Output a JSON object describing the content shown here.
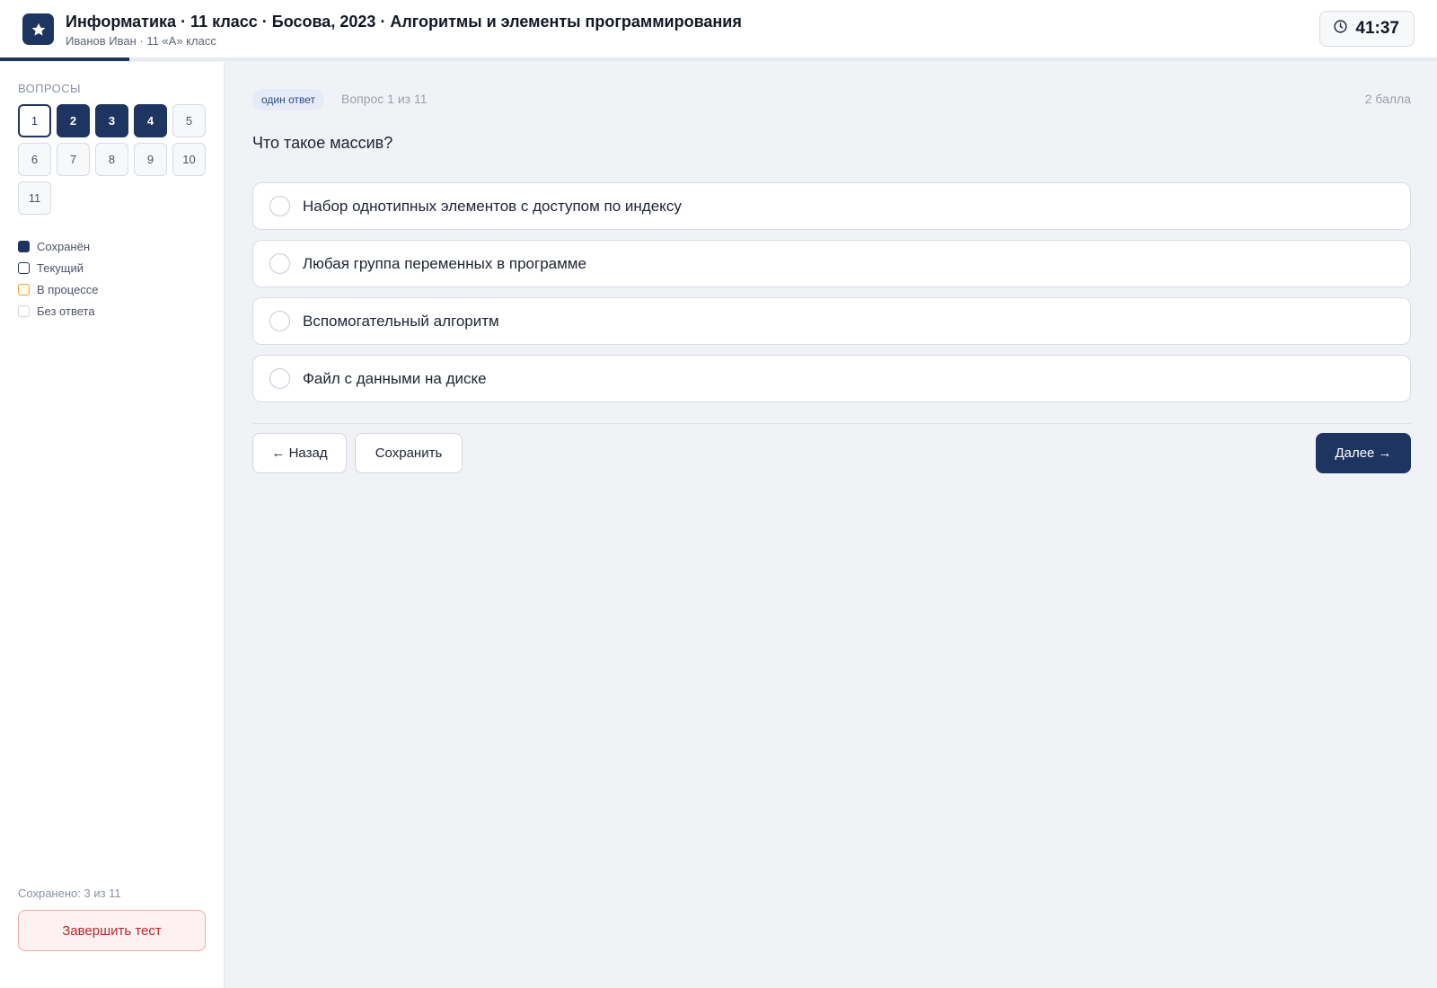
{
  "header": {
    "title": "Информатика · 11 класс · Босова, 2023 · Алгоритмы и элементы программирования",
    "subtitle": "Иванов Иван · 11 «А» класс",
    "timer": "41:37",
    "logo_icon": "star-icon",
    "timer_icon": "clock-icon",
    "progress_fraction": 0.09
  },
  "sidebar": {
    "heading": "ВОПРОСЫ",
    "questions": [
      {
        "label": "1",
        "state": "current"
      },
      {
        "label": "2",
        "state": "saved"
      },
      {
        "label": "3",
        "state": "saved"
      },
      {
        "label": "4",
        "state": "saved"
      },
      {
        "label": "5",
        "state": "none"
      },
      {
        "label": "6",
        "state": "none"
      },
      {
        "label": "7",
        "state": "none"
      },
      {
        "label": "8",
        "state": "none"
      },
      {
        "label": "9",
        "state": "none"
      },
      {
        "label": "10",
        "state": "none"
      },
      {
        "label": "11",
        "state": "none"
      }
    ],
    "legend": [
      {
        "label": "Сохранён",
        "kind": "saved"
      },
      {
        "label": "Текущий",
        "kind": "current"
      },
      {
        "label": "В процессе",
        "kind": "progress"
      },
      {
        "label": "Без ответа",
        "kind": "none"
      }
    ],
    "saved_count": "Сохранено: 3 из 11",
    "finish_label": "Завершить тест"
  },
  "main": {
    "badge": "один ответ",
    "counter": "Вопрос 1 из 11",
    "points": "2 балла",
    "question": "Что такое массив?",
    "options": [
      "Набор однотипных элементов с доступом по индексу",
      "Любая группа переменных в программе",
      "Вспомогательный алгоритм",
      "Файл с данными на диске"
    ],
    "back_label": "← Назад",
    "save_label": "Сохранить",
    "next_label": "Далее →"
  },
  "colors": {
    "accent": "#1e3461",
    "danger": "#b42b2b",
    "in_progress": "#e3a93a"
  }
}
